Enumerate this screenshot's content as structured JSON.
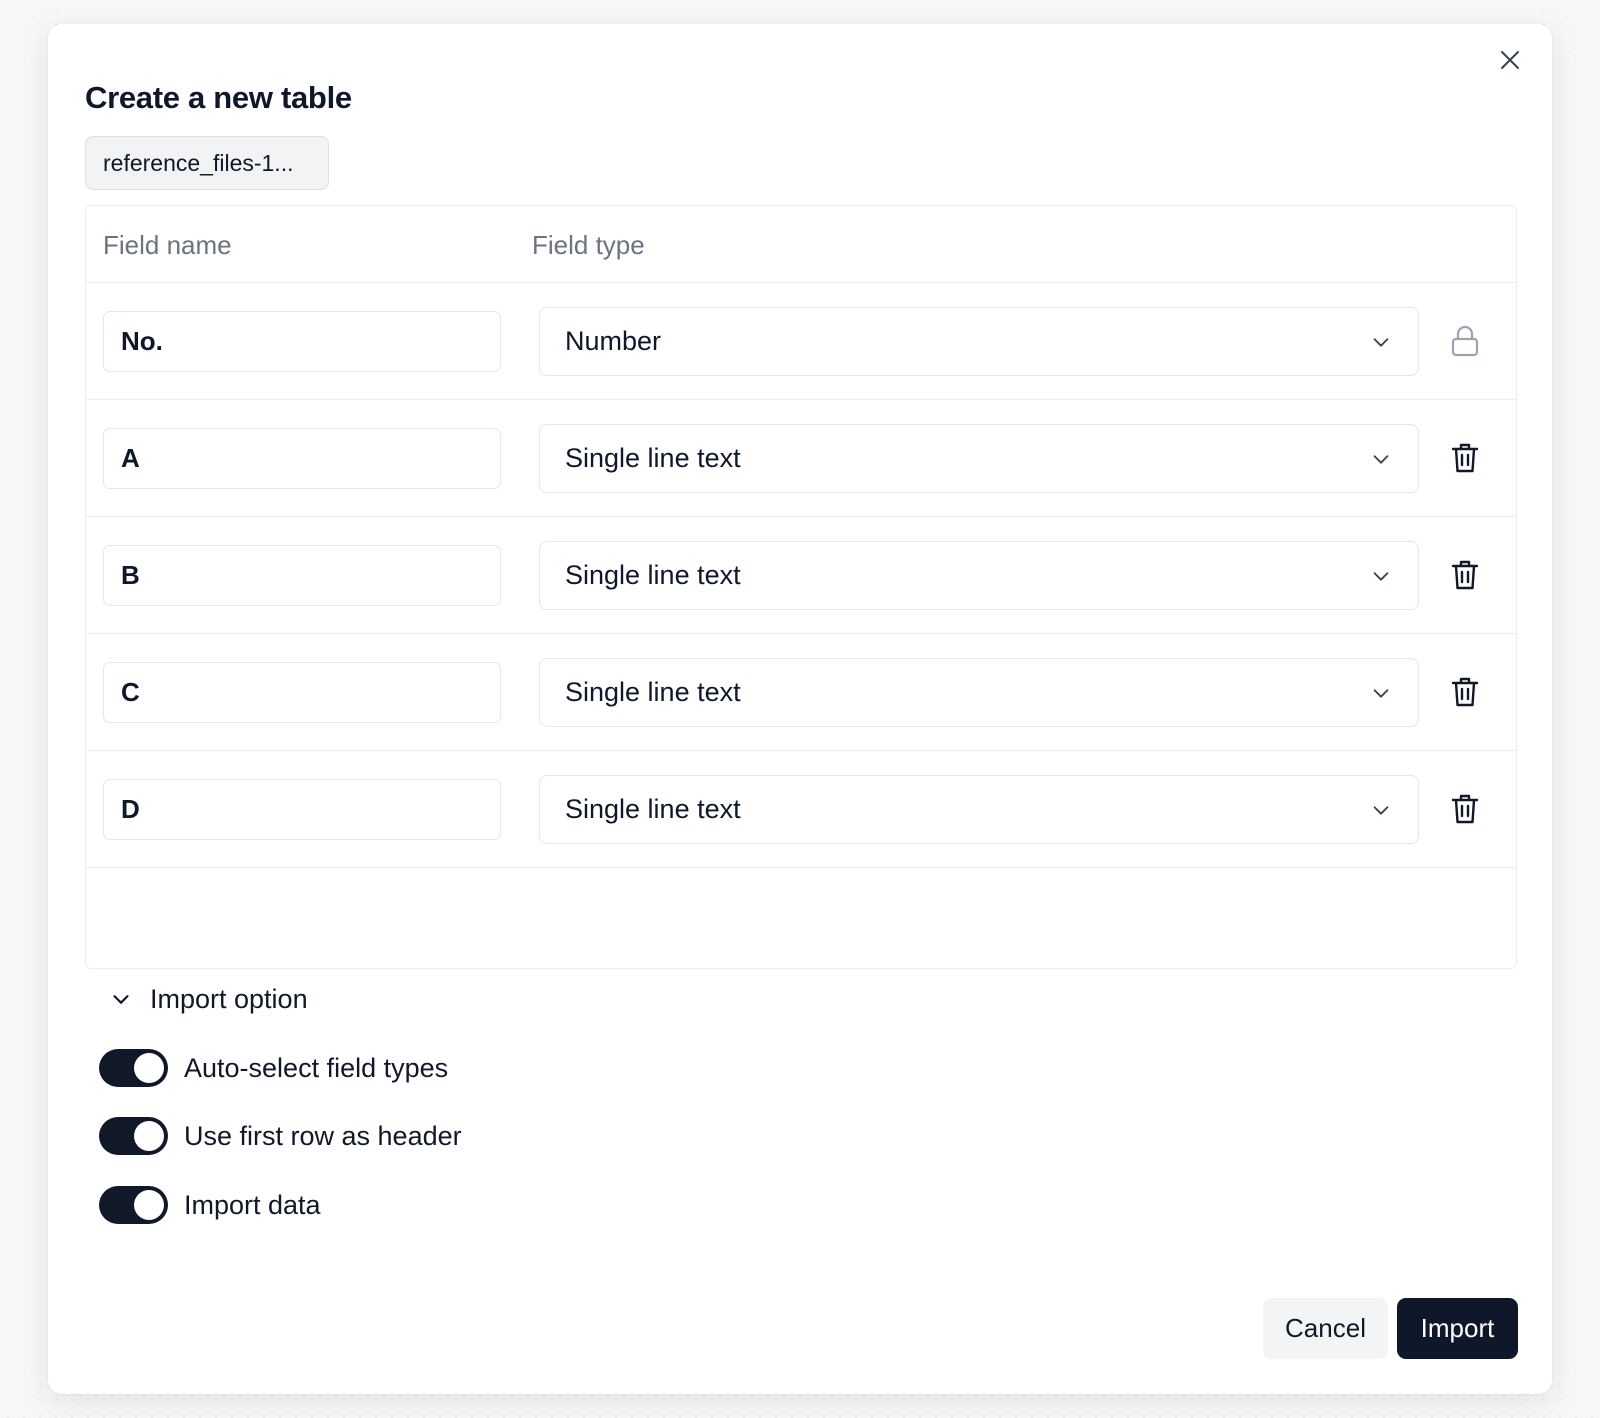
{
  "dialog": {
    "title": "Create a new table",
    "file_tab": "reference_files-1..."
  },
  "table": {
    "headers": {
      "field_name": "Field name",
      "field_type": "Field type"
    },
    "rows": [
      {
        "name": "No.",
        "type": "Number",
        "action_icon": "lock-icon"
      },
      {
        "name": "A",
        "type": "Single line text",
        "action_icon": "trash-icon"
      },
      {
        "name": "B",
        "type": "Single line text",
        "action_icon": "trash-icon"
      },
      {
        "name": "C",
        "type": "Single line text",
        "action_icon": "trash-icon"
      },
      {
        "name": "D",
        "type": "Single line text",
        "action_icon": "trash-icon"
      }
    ]
  },
  "import_options": {
    "label": "Import option",
    "expanded": true,
    "switches": [
      {
        "label": "Auto-select field types",
        "on": true
      },
      {
        "label": "Use first row as header",
        "on": true
      },
      {
        "label": "Import data",
        "on": true
      }
    ]
  },
  "footer": {
    "cancel_label": "Cancel",
    "import_label": "Import"
  },
  "colors": {
    "primary": "#0f172a",
    "muted_text": "#6b7280",
    "border": "#e3e6ea"
  }
}
